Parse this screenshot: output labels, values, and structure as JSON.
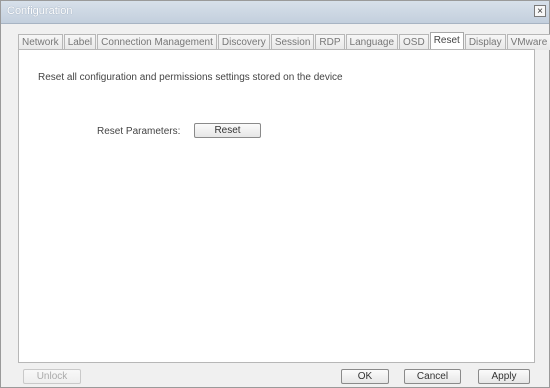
{
  "window": {
    "title": "Configuration",
    "close_label": "×"
  },
  "tabs": [
    {
      "label": "Network"
    },
    {
      "label": "Label"
    },
    {
      "label": "Connection Management"
    },
    {
      "label": "Discovery"
    },
    {
      "label": "Session"
    },
    {
      "label": "RDP"
    },
    {
      "label": "Language"
    },
    {
      "label": "OSD"
    },
    {
      "label": "Reset",
      "active": true
    },
    {
      "label": "Display"
    },
    {
      "label": "VMware View"
    }
  ],
  "content": {
    "description": "Reset all configuration and permissions settings stored on the device",
    "reset_parameters_label": "Reset Parameters:",
    "reset_button": "Reset"
  },
  "footer": {
    "unlock": "Unlock",
    "ok": "OK",
    "cancel": "Cancel",
    "apply": "Apply"
  }
}
